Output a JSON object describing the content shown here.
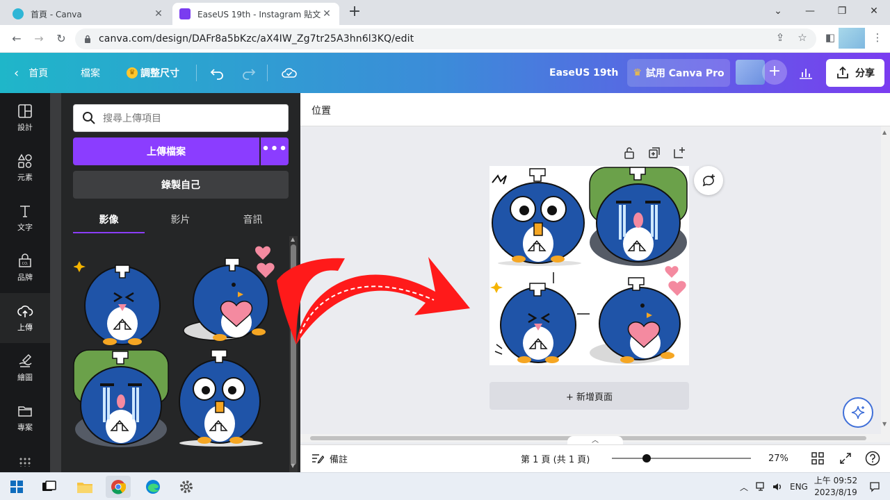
{
  "browser": {
    "tabs": [
      {
        "title": "首頁 - Canva",
        "active": false
      },
      {
        "title": "EaseUS 19th - Instagram 貼文",
        "active": true
      }
    ],
    "url": "canva.com/design/DAFr8a5bKzc/aX4IW_Zg7tr25A3hn6l3KQ/edit"
  },
  "header": {
    "home": "首頁",
    "file": "檔案",
    "resize": "調整尺寸",
    "doc_title": "EaseUS 19th",
    "pro": "試用 Canva Pro",
    "share": "分享",
    "gradient": [
      "#1fb6c9",
      "#7a3cf0"
    ]
  },
  "rail": [
    {
      "label": "設計",
      "icon": "design-icon"
    },
    {
      "label": "元素",
      "icon": "elements-icon"
    },
    {
      "label": "文字",
      "icon": "text-icon"
    },
    {
      "label": "品牌",
      "icon": "brand-icon"
    },
    {
      "label": "上傳",
      "icon": "upload-icon",
      "active": true
    },
    {
      "label": "繪圖",
      "icon": "draw-icon"
    },
    {
      "label": "專案",
      "icon": "folder-icon"
    }
  ],
  "panel": {
    "search_placeholder": "搜尋上傳項目",
    "upload_label": "上傳檔案",
    "record_label": "錄製自己",
    "tabs": [
      "影像",
      "影片",
      "音訊"
    ],
    "accent": "#8b3dff"
  },
  "editor": {
    "position_label": "位置",
    "add_page": "+ 新增頁面"
  },
  "footer": {
    "notes": "備註",
    "page_info": "第 1 頁 (共 1 頁)",
    "zoom": "27%"
  },
  "taskbar": {
    "lang": "ENG",
    "time": "上午 09:52",
    "date": "2023/8/19"
  }
}
